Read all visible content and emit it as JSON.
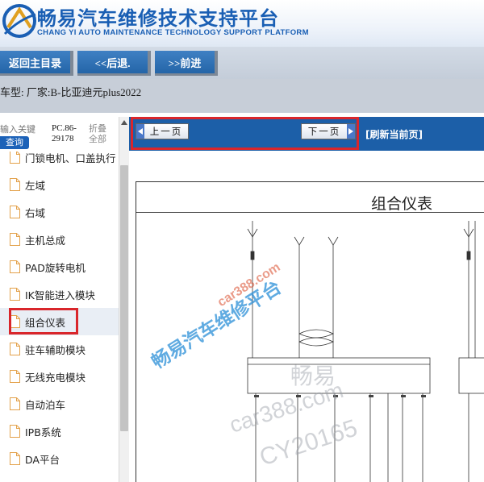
{
  "header": {
    "title": "畅易汽车维修技术支持平台",
    "subtitle": "CHANG YI AUTO MAINTENANCE TECHNOLOGY SUPPORT PLATFORM"
  },
  "nav": {
    "home_label": "返回主目录",
    "back_label": "<<后退.",
    "forward_label": ">>前进"
  },
  "vehicle": {
    "label": "车型:  厂家:B-比亚迪元plus2022"
  },
  "sidebar": {
    "search_placeholder": "输入关键",
    "search_button": "查询",
    "pc_code": "PC.86-29178",
    "collapse_label": "折叠全部",
    "items": [
      {
        "label": "门锁电机、口盖执行"
      },
      {
        "label": "左域"
      },
      {
        "label": "右域"
      },
      {
        "label": "主机总成"
      },
      {
        "label": "PAD旋转电机"
      },
      {
        "label": "IK智能进入模块"
      },
      {
        "label": "组合仪表"
      },
      {
        "label": "驻车辅助模块"
      },
      {
        "label": "无线充电模块"
      },
      {
        "label": "自动泊车"
      },
      {
        "label": "IPB系统"
      },
      {
        "label": "DA平台"
      }
    ],
    "selected_index": 6
  },
  "pager": {
    "prev_label": "上一页",
    "next_label": "下一页",
    "refresh_label": "[刷新当前页]"
  },
  "diagram": {
    "title": "组合仪表"
  },
  "watermarks": {
    "site": "car388.com",
    "platform": "畅易汽车维修平台",
    "brand": "畅易",
    "site2": "car388.com",
    "code": "CY20165"
  },
  "colors": {
    "brand_blue": "#1a5fb4",
    "nav_button": "#2e6fb3",
    "pager_bar": "#1c5fa8",
    "highlight_red": "#d9262b",
    "watermark_red": "#d94b2a",
    "watermark_blue": "#2b8fd8"
  },
  "icons": {
    "logo": "chang-yi-logo",
    "tree_item": "document-icon",
    "prev": "arrow-left-icon",
    "next": "arrow-right-icon"
  }
}
